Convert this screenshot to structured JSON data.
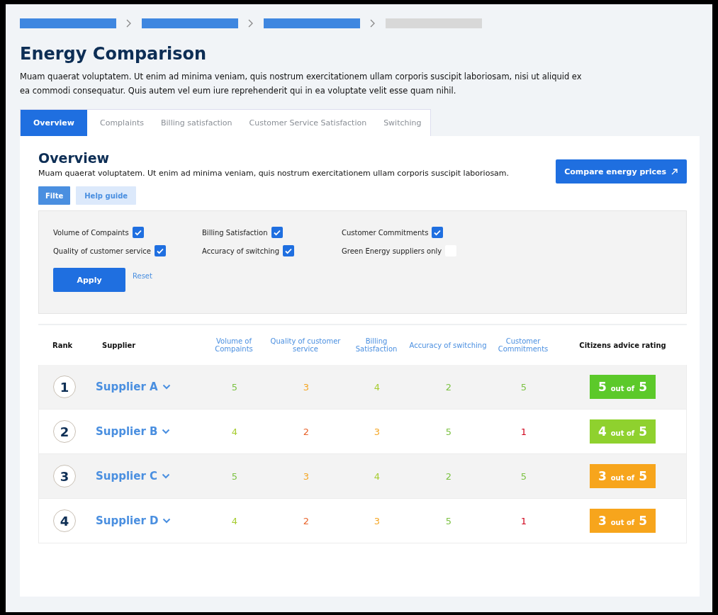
{
  "breadcrumbs": [
    {
      "current": false
    },
    {
      "current": false
    },
    {
      "current": false
    },
    {
      "current": true
    }
  ],
  "title": "Energy Comparison",
  "intro": "Muam quaerat voluptatem. Ut enim ad minima veniam, quis nostrum exercitationem ullam corporis suscipit laboriosam, nisi ut aliquid ex ea commodi consequatur. Quis autem vel eum iure reprehenderit qui in ea voluptate velit esse quam nihil.",
  "tabs": [
    {
      "label": "Overview",
      "selected": true
    },
    {
      "label": "Complaints",
      "selected": false
    },
    {
      "label": "Billing satisfaction",
      "selected": false
    },
    {
      "label": "Customer Service Satisfaction",
      "selected": false
    },
    {
      "label": "Switching",
      "selected": false
    }
  ],
  "overview": {
    "heading": "Overview",
    "text": "Muam quaerat voluptatem. Ut enim ad minima veniam, quis nostrum exercitationem ullam corporis suscipit laboriosam.",
    "compare_button": "Compare energy prices",
    "view_buttons": [
      {
        "label": "Filte",
        "selected": true
      },
      {
        "label": "Help guide",
        "selected": false
      }
    ]
  },
  "filters": [
    {
      "label": "Volume of Compaints",
      "checked": true
    },
    {
      "label": "Billing Satisfaction",
      "checked": true
    },
    {
      "label": "Customer Commitments",
      "checked": true
    },
    {
      "label": "Quality of  customer service",
      "checked": true
    },
    {
      "label": "Accuracy of switching",
      "checked": true
    },
    {
      "label": "Green Energy suppliers only",
      "checked": false
    }
  ],
  "apply_button": "Apply",
  "reset_link": "Reset",
  "table": {
    "columns": [
      {
        "label": "Rank",
        "kind": "plain"
      },
      {
        "label": "Supplier",
        "kind": "plain"
      },
      {
        "label": "Volume of Compaints",
        "kind": "metric"
      },
      {
        "label": "Quality of customer service",
        "kind": "metric"
      },
      {
        "label": "Billing Satisfaction",
        "kind": "metric"
      },
      {
        "label": "Accuracy of switching",
        "kind": "metric"
      },
      {
        "label": "Customer Commitments",
        "kind": "metric"
      },
      {
        "label": "Citizens advice rating",
        "kind": "plain"
      }
    ],
    "rows": [
      {
        "rank": "1",
        "supplier": "Supplier A",
        "scores": [
          {
            "value": "5",
            "color": "#7cc243"
          },
          {
            "value": "3",
            "color": "#f5a623"
          },
          {
            "value": "4",
            "color": "#a6cc2e"
          },
          {
            "value": "2",
            "color": "#7cc243"
          },
          {
            "value": "5",
            "color": "#7cc243"
          }
        ],
        "rating": {
          "score": "5",
          "label": "out of",
          "max": "5",
          "color": "#5cc92a"
        }
      },
      {
        "rank": "2",
        "supplier": "Supplier B",
        "scores": [
          {
            "value": "4",
            "color": "#a6cc2e"
          },
          {
            "value": "2",
            "color": "#e8632a"
          },
          {
            "value": "3",
            "color": "#f5a623"
          },
          {
            "value": "5",
            "color": "#7cc243"
          },
          {
            "value": "1",
            "color": "#d0021b"
          }
        ],
        "rating": {
          "score": "4",
          "label": "out of",
          "max": "5",
          "color": "#8fd12e"
        }
      },
      {
        "rank": "3",
        "supplier": "Supplier C",
        "scores": [
          {
            "value": "5",
            "color": "#7cc243"
          },
          {
            "value": "3",
            "color": "#f5a623"
          },
          {
            "value": "4",
            "color": "#a6cc2e"
          },
          {
            "value": "2",
            "color": "#7cc243"
          },
          {
            "value": "5",
            "color": "#7cc243"
          }
        ],
        "rating": {
          "score": "3",
          "label": "out of",
          "max": "5",
          "color": "#f7a51c"
        }
      },
      {
        "rank": "4",
        "supplier": "Supplier D",
        "scores": [
          {
            "value": "4",
            "color": "#a6cc2e"
          },
          {
            "value": "2",
            "color": "#e8632a"
          },
          {
            "value": "3",
            "color": "#f5a623"
          },
          {
            "value": "5",
            "color": "#7cc243"
          },
          {
            "value": "1",
            "color": "#d0021b"
          }
        ],
        "rating": {
          "score": "3",
          "label": "out of",
          "max": "5",
          "color": "#f7a51c"
        }
      }
    ]
  }
}
